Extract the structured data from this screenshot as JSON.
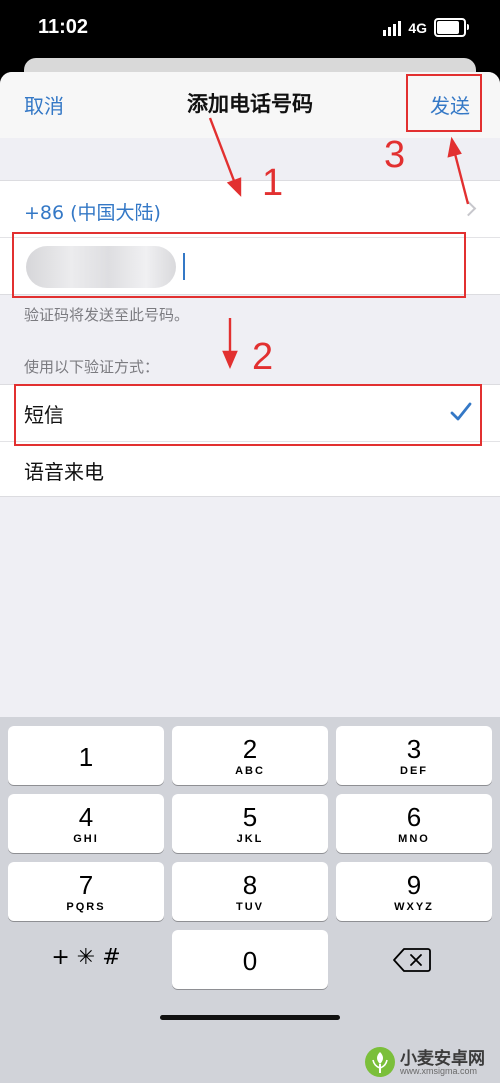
{
  "status_bar": {
    "time": "11:02",
    "network": "4G",
    "battery_level": 0.85
  },
  "nav": {
    "cancel": "取消",
    "title": "添加电话号码",
    "send": "发送"
  },
  "country_code": "+86 (中国大陆)",
  "hint_text": "验证码将发送至此号码。",
  "verify_section_label": "使用以下验证方式：",
  "options": [
    {
      "label": "短信",
      "selected": true
    },
    {
      "label": "语音来电",
      "selected": false
    }
  ],
  "annotations": {
    "step1": "1",
    "step2": "2",
    "step3": "3",
    "color": "#e23030"
  },
  "keypad": {
    "keys": [
      {
        "digit": "1",
        "letters": ""
      },
      {
        "digit": "2",
        "letters": "ABC"
      },
      {
        "digit": "3",
        "letters": "DEF"
      },
      {
        "digit": "4",
        "letters": "GHI"
      },
      {
        "digit": "5",
        "letters": "JKL"
      },
      {
        "digit": "6",
        "letters": "MNO"
      },
      {
        "digit": "7",
        "letters": "PQRS"
      },
      {
        "digit": "8",
        "letters": "TUV"
      },
      {
        "digit": "9",
        "letters": "WXYZ"
      }
    ],
    "symbols": "+ ✳ #",
    "zero": "0"
  },
  "watermark": {
    "title": "小麦安卓网",
    "url": "www.xmsigma.com"
  },
  "colors": {
    "accent": "#3478c6",
    "background": "#efeff4",
    "keypad_bg": "#d1d3d9"
  }
}
